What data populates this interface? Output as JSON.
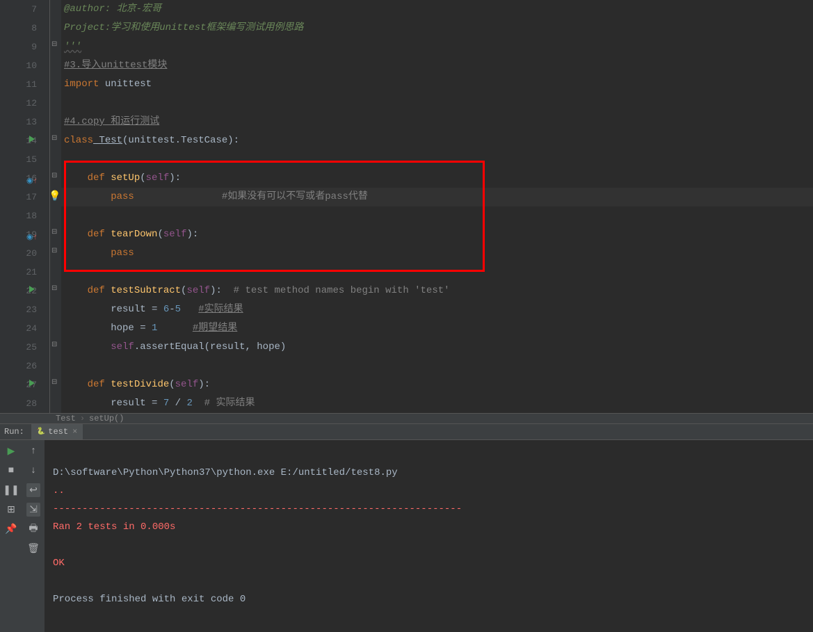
{
  "gutter": {
    "lines": [
      "7",
      "8",
      "9",
      "10",
      "11",
      "12",
      "13",
      "14",
      "15",
      "16",
      "17",
      "18",
      "19",
      "20",
      "21",
      "22",
      "23",
      "24",
      "25",
      "26",
      "27",
      "28"
    ]
  },
  "code": {
    "l7": "@author: 北京-宏哥",
    "l8": "Project:学习和使用unittest框架编写测试用例思路",
    "l9": "'''",
    "l10": "#3.导入unittest模块",
    "l11_import": "import",
    "l11_mod": " unittest",
    "l13": "#4.copy 和运行测试",
    "l14_class": "class",
    "l14_name": " Test",
    "l14_rest": "(unittest.TestCase):",
    "l16_def": "def",
    "l16_fn": " setUp",
    "l16_self": "self",
    "l17_pass": "pass",
    "l17_cmt": "#如果没有可以不写或者pass代替",
    "l19_def": "def",
    "l19_fn": " tearDown",
    "l19_self": "self",
    "l20_pass": "pass",
    "l22_def": "def",
    "l22_fn": " testSubtract",
    "l22_self": "self",
    "l22_cmt": "  # test method names begin with 'test'",
    "l23a": "result = ",
    "l23n1": "6",
    "l23dash": "-",
    "l23n2": "5",
    "l23sp": "   ",
    "l23cmt": "#实际结果",
    "l24a": "hope = ",
    "l24n": "1",
    "l24sp": "      ",
    "l24cmt": "#期望结果",
    "l25_self": "self",
    "l25_dot": ".",
    "l25_fn": "assertEqual",
    "l25_args": "(result, hope)",
    "l27_def": "def",
    "l27_fn": " testDivide",
    "l27_self": "self",
    "l28a": "result = ",
    "l28n1": "7",
    "l28op": " / ",
    "l28n2": "2",
    "l28cmt": "  # 实际结果"
  },
  "breadcrumb": {
    "class": "Test",
    "method": "setUp()"
  },
  "run": {
    "label": "Run:",
    "tab": "test"
  },
  "console": {
    "cmd": "D:\\software\\Python\\Python37\\python.exe E:/untitled/test8.py",
    "dots": "..",
    "dash": "----------------------------------------------------------------------",
    "ran": "Ran 2 tests in 0.000s",
    "ok": "OK",
    "exit": "Process finished with exit code 0"
  }
}
